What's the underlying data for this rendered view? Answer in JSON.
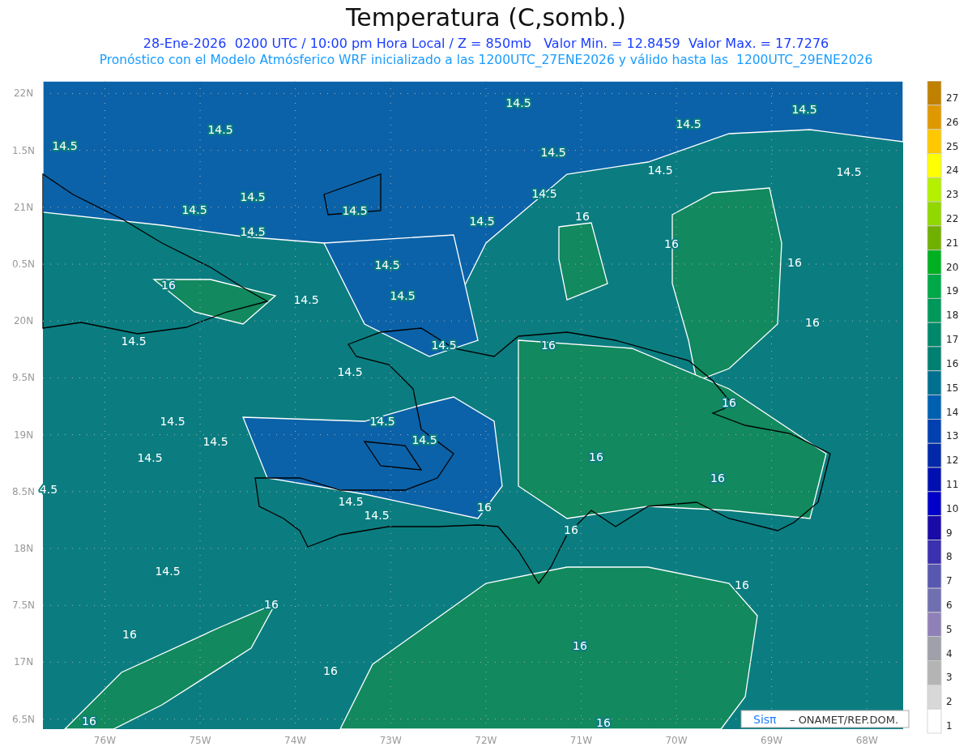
{
  "title": "Temperatura (C,somb.)",
  "info_line": "28-Ene-2026  0200 UTC / 10:00 pm Hora Local / Z = 850mb   Valor Min. = 12.8459  Valor Max. = 17.7276",
  "forecast_line": "Pronóstico con el Modelo Atmósferico WRF inicializado a las 1200UTC_27ENE2026 y válido hasta las  1200UTC_29ENE2026",
  "map": {
    "y_axis": [
      "22N",
      "1.5N",
      "21N",
      "0.5N",
      "20N",
      "9.5N",
      "19N",
      "8.5N",
      "18N",
      "7.5N",
      "17N",
      "6.5N"
    ],
    "x_axis": [
      "76W",
      "75W",
      "74W",
      "73W",
      "72W",
      "71W",
      "70W",
      "69W",
      "68W"
    ],
    "contour_labels": [
      "14.5",
      "14.5",
      "14.5",
      "14.5",
      "14.5",
      "14.5",
      "14.5",
      "14.5",
      "14.5",
      "14.5",
      "14.5",
      "14.5",
      "16",
      "14.5",
      "14.5",
      "16",
      "16",
      "14.5",
      "16",
      "14.5",
      "14.5",
      "16",
      "14.5",
      "14.5",
      "16",
      "14.5",
      "16",
      "14.5",
      "14.5",
      "14.5",
      "14.5",
      "16",
      "14.5",
      "16",
      "4.5",
      "14.5",
      "16",
      "14.5",
      "16",
      "14.5",
      "16",
      "16",
      "16",
      "16",
      "16",
      "16",
      "16"
    ]
  },
  "legend": [
    {
      "label": "27",
      "color": "#c08000"
    },
    {
      "label": "26",
      "color": "#e09800"
    },
    {
      "label": "25",
      "color": "#ffc800"
    },
    {
      "label": "24",
      "color": "#ffff00"
    },
    {
      "label": "23",
      "color": "#b4f000"
    },
    {
      "label": "22",
      "color": "#90d800"
    },
    {
      "label": "21",
      "color": "#70b000"
    },
    {
      "label": "20",
      "color": "#00b020"
    },
    {
      "label": "19",
      "color": "#00a848"
    },
    {
      "label": "18",
      "color": "#00985a"
    },
    {
      "label": "17",
      "color": "#00886a"
    },
    {
      "label": "16",
      "color": "#008070"
    },
    {
      "label": "15",
      "color": "#00708e"
    },
    {
      "label": "14",
      "color": "#0060b0"
    },
    {
      "label": "13",
      "color": "#0040b0"
    },
    {
      "label": "12",
      "color": "#0028a8"
    },
    {
      "label": "11",
      "color": "#0010b0"
    },
    {
      "label": "10",
      "color": "#0000c8"
    },
    {
      "label": "9",
      "color": "#1a0aa8"
    },
    {
      "label": "8",
      "color": "#3a30b0"
    },
    {
      "label": "7",
      "color": "#5858b0"
    },
    {
      "label": "6",
      "color": "#7070b0"
    },
    {
      "label": "5",
      "color": "#9080b8"
    },
    {
      "label": "4",
      "color": "#a0a0aa"
    },
    {
      "label": "3",
      "color": "#b4b4b4"
    },
    {
      "label": "2",
      "color": "#d8d8d8"
    },
    {
      "label": "1",
      "color": "#ffffff"
    }
  ],
  "credit": {
    "logo": "Sisπ",
    "text": "– ONAMET/REP.DOM."
  }
}
